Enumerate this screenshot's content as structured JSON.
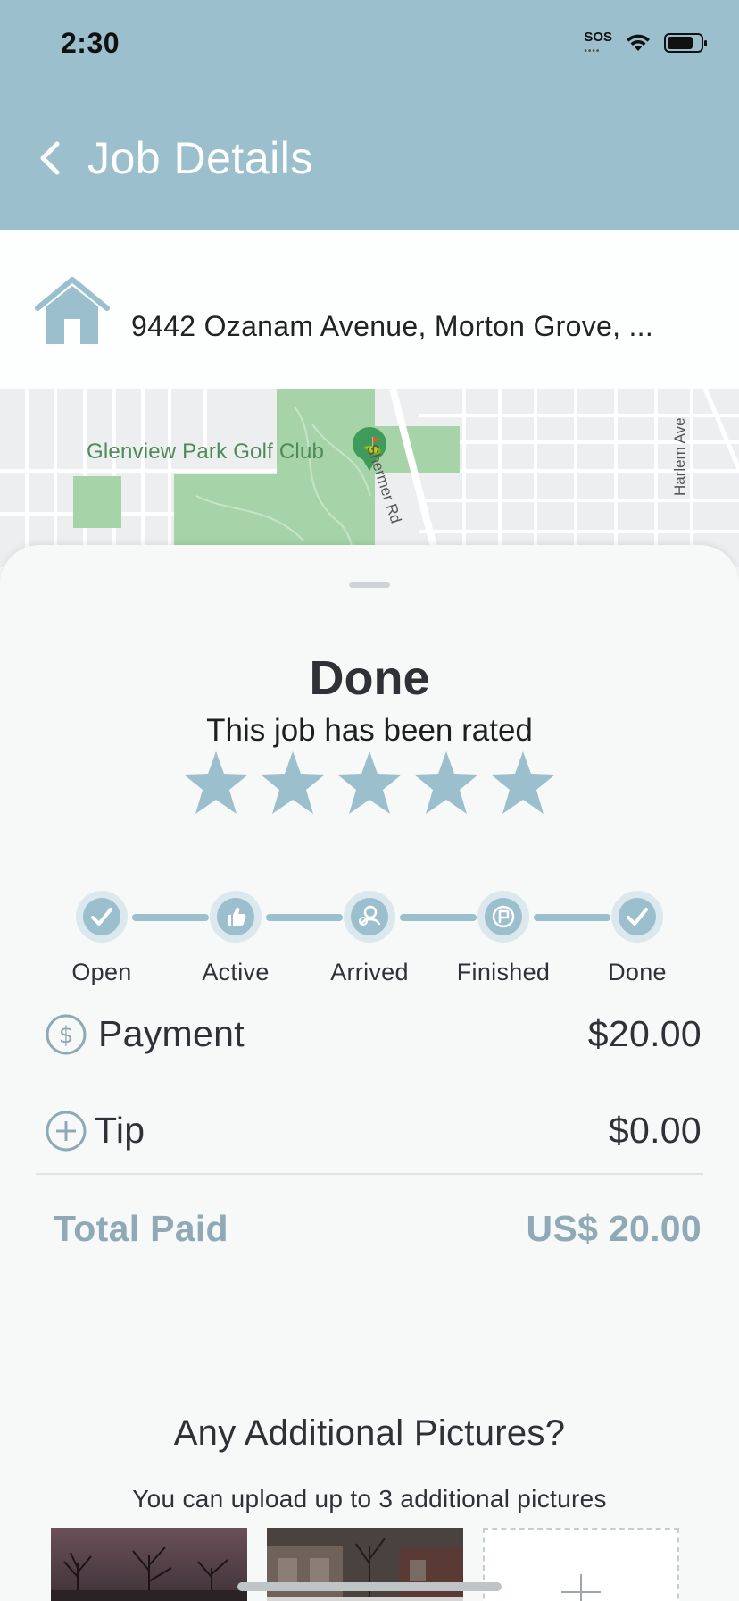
{
  "status_bar": {
    "time": "2:30",
    "sos": "SOS"
  },
  "header": {
    "title": "Job Details"
  },
  "address": {
    "text": "9442 Ozanam Avenue, Morton Grove, ..."
  },
  "map": {
    "place_label": "Glenview Park Golf Club",
    "road_1": "Shermer Rd",
    "road_2": "Harlem Ave"
  },
  "job": {
    "status": "Done",
    "rating_text": "This job has been rated",
    "rating": 5,
    "rating_max": 5
  },
  "progress": {
    "steps": [
      {
        "label": "Open",
        "icon": "check-icon"
      },
      {
        "label": "Active",
        "icon": "thumbs-up-icon"
      },
      {
        "label": "Arrived",
        "icon": "arrived-icon"
      },
      {
        "label": "Finished",
        "icon": "flag-icon"
      },
      {
        "label": "Done",
        "icon": "check-icon"
      }
    ],
    "completed": 5
  },
  "payment": {
    "payment_label": "Payment",
    "payment_value": "$20.00",
    "tip_label": "Tip",
    "tip_value": "$0.00",
    "total_label": "Total Paid",
    "total_value": "US$ 20.00"
  },
  "pictures": {
    "heading": "Any Additional Pictures?",
    "subheading": "You can upload up to 3 additional pictures"
  },
  "colors": {
    "accent": "#9bbfcd",
    "total_text": "#8fa9b6",
    "map_green": "#a7d3a9"
  }
}
